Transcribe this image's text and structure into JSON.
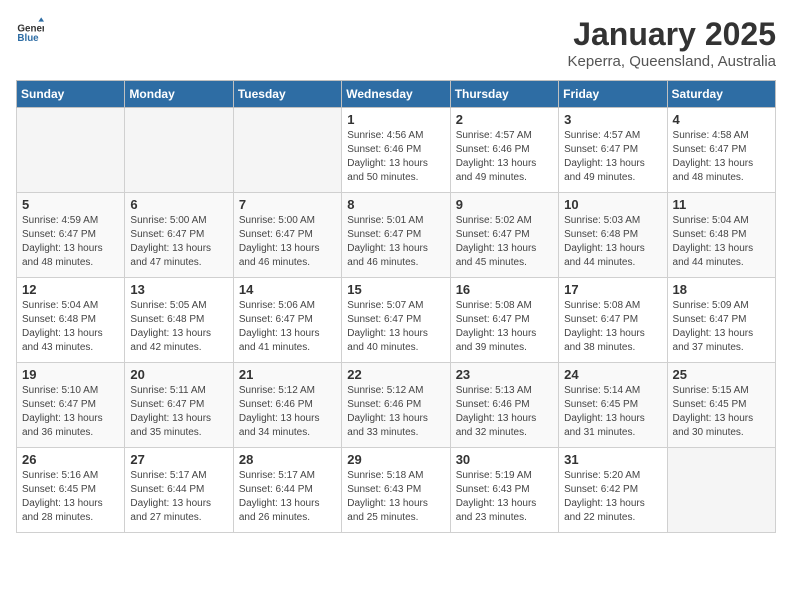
{
  "header": {
    "logo_general": "General",
    "logo_blue": "Blue",
    "title": "January 2025",
    "subtitle": "Keperra, Queensland, Australia"
  },
  "days_of_week": [
    "Sunday",
    "Monday",
    "Tuesday",
    "Wednesday",
    "Thursday",
    "Friday",
    "Saturday"
  ],
  "weeks": [
    [
      {
        "day": "",
        "empty": true
      },
      {
        "day": "",
        "empty": true
      },
      {
        "day": "",
        "empty": true
      },
      {
        "day": "1",
        "sunrise": "4:56 AM",
        "sunset": "6:46 PM",
        "daylight": "13 hours and 50 minutes."
      },
      {
        "day": "2",
        "sunrise": "4:57 AM",
        "sunset": "6:46 PM",
        "daylight": "13 hours and 49 minutes."
      },
      {
        "day": "3",
        "sunrise": "4:57 AM",
        "sunset": "6:47 PM",
        "daylight": "13 hours and 49 minutes."
      },
      {
        "day": "4",
        "sunrise": "4:58 AM",
        "sunset": "6:47 PM",
        "daylight": "13 hours and 48 minutes."
      }
    ],
    [
      {
        "day": "5",
        "sunrise": "4:59 AM",
        "sunset": "6:47 PM",
        "daylight": "13 hours and 48 minutes."
      },
      {
        "day": "6",
        "sunrise": "5:00 AM",
        "sunset": "6:47 PM",
        "daylight": "13 hours and 47 minutes."
      },
      {
        "day": "7",
        "sunrise": "5:00 AM",
        "sunset": "6:47 PM",
        "daylight": "13 hours and 46 minutes."
      },
      {
        "day": "8",
        "sunrise": "5:01 AM",
        "sunset": "6:47 PM",
        "daylight": "13 hours and 46 minutes."
      },
      {
        "day": "9",
        "sunrise": "5:02 AM",
        "sunset": "6:47 PM",
        "daylight": "13 hours and 45 minutes."
      },
      {
        "day": "10",
        "sunrise": "5:03 AM",
        "sunset": "6:48 PM",
        "daylight": "13 hours and 44 minutes."
      },
      {
        "day": "11",
        "sunrise": "5:04 AM",
        "sunset": "6:48 PM",
        "daylight": "13 hours and 44 minutes."
      }
    ],
    [
      {
        "day": "12",
        "sunrise": "5:04 AM",
        "sunset": "6:48 PM",
        "daylight": "13 hours and 43 minutes."
      },
      {
        "day": "13",
        "sunrise": "5:05 AM",
        "sunset": "6:48 PM",
        "daylight": "13 hours and 42 minutes."
      },
      {
        "day": "14",
        "sunrise": "5:06 AM",
        "sunset": "6:47 PM",
        "daylight": "13 hours and 41 minutes."
      },
      {
        "day": "15",
        "sunrise": "5:07 AM",
        "sunset": "6:47 PM",
        "daylight": "13 hours and 40 minutes."
      },
      {
        "day": "16",
        "sunrise": "5:08 AM",
        "sunset": "6:47 PM",
        "daylight": "13 hours and 39 minutes."
      },
      {
        "day": "17",
        "sunrise": "5:08 AM",
        "sunset": "6:47 PM",
        "daylight": "13 hours and 38 minutes."
      },
      {
        "day": "18",
        "sunrise": "5:09 AM",
        "sunset": "6:47 PM",
        "daylight": "13 hours and 37 minutes."
      }
    ],
    [
      {
        "day": "19",
        "sunrise": "5:10 AM",
        "sunset": "6:47 PM",
        "daylight": "13 hours and 36 minutes."
      },
      {
        "day": "20",
        "sunrise": "5:11 AM",
        "sunset": "6:47 PM",
        "daylight": "13 hours and 35 minutes."
      },
      {
        "day": "21",
        "sunrise": "5:12 AM",
        "sunset": "6:46 PM",
        "daylight": "13 hours and 34 minutes."
      },
      {
        "day": "22",
        "sunrise": "5:12 AM",
        "sunset": "6:46 PM",
        "daylight": "13 hours and 33 minutes."
      },
      {
        "day": "23",
        "sunrise": "5:13 AM",
        "sunset": "6:46 PM",
        "daylight": "13 hours and 32 minutes."
      },
      {
        "day": "24",
        "sunrise": "5:14 AM",
        "sunset": "6:45 PM",
        "daylight": "13 hours and 31 minutes."
      },
      {
        "day": "25",
        "sunrise": "5:15 AM",
        "sunset": "6:45 PM",
        "daylight": "13 hours and 30 minutes."
      }
    ],
    [
      {
        "day": "26",
        "sunrise": "5:16 AM",
        "sunset": "6:45 PM",
        "daylight": "13 hours and 28 minutes."
      },
      {
        "day": "27",
        "sunrise": "5:17 AM",
        "sunset": "6:44 PM",
        "daylight": "13 hours and 27 minutes."
      },
      {
        "day": "28",
        "sunrise": "5:17 AM",
        "sunset": "6:44 PM",
        "daylight": "13 hours and 26 minutes."
      },
      {
        "day": "29",
        "sunrise": "5:18 AM",
        "sunset": "6:43 PM",
        "daylight": "13 hours and 25 minutes."
      },
      {
        "day": "30",
        "sunrise": "5:19 AM",
        "sunset": "6:43 PM",
        "daylight": "13 hours and 23 minutes."
      },
      {
        "day": "31",
        "sunrise": "5:20 AM",
        "sunset": "6:42 PM",
        "daylight": "13 hours and 22 minutes."
      },
      {
        "day": "",
        "empty": true
      }
    ]
  ]
}
